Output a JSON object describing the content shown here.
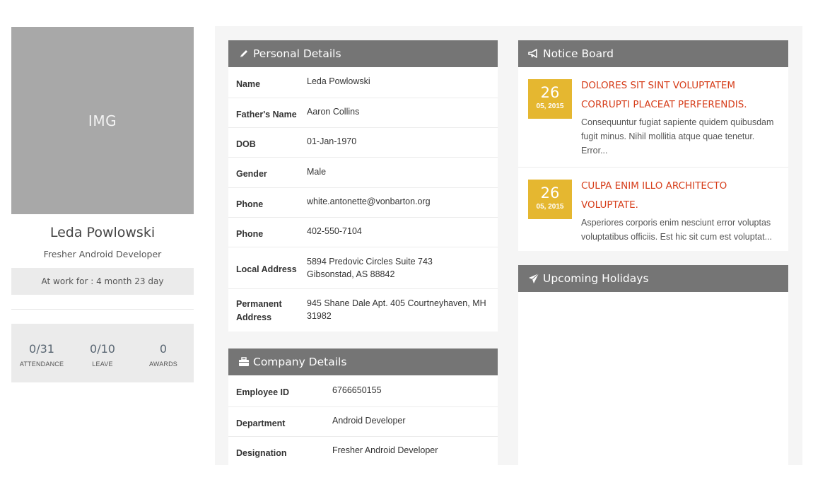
{
  "profile": {
    "image_placeholder": "IMG",
    "name": "Leda Powlowski",
    "role": "Fresher Android Developer",
    "work_duration": "At work for : 4 month 23 day",
    "stats": [
      {
        "value": "0/31",
        "label": "ATTENDANCE"
      },
      {
        "value": "0/10",
        "label": "LEAVE"
      },
      {
        "value": "0",
        "label": "AWARDS"
      }
    ]
  },
  "personal": {
    "title": "Personal Details",
    "icon": "pencil-icon",
    "rows": [
      {
        "label": "Name",
        "value": "Leda Powlowski"
      },
      {
        "label": "Father's Name",
        "value": "Aaron Collins"
      },
      {
        "label": "DOB",
        "value": "01-Jan-1970"
      },
      {
        "label": "Gender",
        "value": "Male"
      },
      {
        "label": "Phone",
        "value": "white.antonette@vonbarton.org"
      },
      {
        "label": "Phone",
        "value": "402-550-7104"
      },
      {
        "label": "Local Address",
        "value": "5894 Predovic Circles Suite 743 Gibsonstad, AS 88842"
      },
      {
        "label": "Permanent Address",
        "value": "945 Shane Dale Apt. 405 Courtneyhaven, MH 31982"
      }
    ]
  },
  "company": {
    "title": "Company Details",
    "icon": "briefcase-icon",
    "rows": [
      {
        "label": "Employee ID",
        "value": "6766650155"
      },
      {
        "label": "Department",
        "value": "Android Developer"
      },
      {
        "label": "Designation",
        "value": "Fresher Android Developer"
      }
    ]
  },
  "notice": {
    "title": "Notice Board",
    "icon": "bullhorn-icon",
    "items": [
      {
        "day": "26",
        "month_year": "05, 2015",
        "title": "DOLORES SIT SINT VOLUPTATEM CORRUPTI PLACEAT PERFERENDIS.",
        "desc": "Consequuntur fugiat sapiente quidem quibusdam fugit minus. Nihil mollitia atque quae tenetur. Error..."
      },
      {
        "day": "26",
        "month_year": "05, 2015",
        "title": "CULPA ENIM ILLO ARCHITECTO VOLUPTATE.",
        "desc": "Asperiores corporis enim nesciunt error voluptas voluptatibus officiis. Est hic sit cum est voluptat..."
      }
    ]
  },
  "holidays": {
    "title": "Upcoming Holidays",
    "icon": "paper-plane-icon"
  },
  "colors": {
    "header_bg": "#757575",
    "date_badge": "#e5b730",
    "notice_title": "#d63d1a"
  }
}
